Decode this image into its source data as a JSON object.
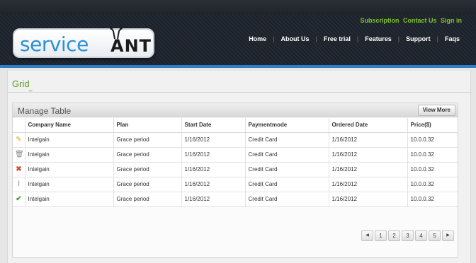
{
  "header": {
    "top_links": [
      "Subscription",
      "Contact Us",
      "Sign in"
    ],
    "logo": {
      "left": "service",
      "right": "ANT"
    },
    "nav": [
      "Home",
      "About Us",
      "Free trial",
      "Features",
      "Support",
      "Faqs"
    ]
  },
  "page": {
    "title": "Grid"
  },
  "panel": {
    "title": "Manage Table",
    "view_more": "View More",
    "columns": [
      "Company Name",
      "Plan",
      "Start Date",
      "Paymentmode",
      "Ordered Date",
      "Price($)"
    ],
    "rows": [
      {
        "icon": "edit-icon",
        "glyph": "✎",
        "cells": [
          "Intelgain",
          "Grace period",
          "1/16/2012",
          "Credit Card",
          "1/16/2012",
          "10.0.0.32"
        ]
      },
      {
        "icon": "trash-icon",
        "glyph": "🗑",
        "cells": [
          "Intelgain",
          "Grace period",
          "1/16/2012",
          "Credit Card",
          "1/16/2012",
          "10.0.0.32"
        ]
      },
      {
        "icon": "delete-x-icon",
        "glyph": "✖",
        "cells": [
          "Intelgain",
          "Grace period",
          "1/16/2012",
          "Credit Card",
          "1/16/2012",
          "10.0.0.32"
        ]
      },
      {
        "icon": "paperclip-icon",
        "glyph": "⌇",
        "cells": [
          "Intelgain",
          "Grace period",
          "1/16/2012",
          "Credit Card",
          "1/16/2012",
          "10.0.0.32"
        ]
      },
      {
        "icon": "checkmark-icon",
        "glyph": "✔",
        "cells": [
          "Intelgain",
          "Grace period",
          "1/16/2012",
          "Credit Card",
          "1/16/2012",
          "10.0.0.32"
        ]
      }
    ]
  },
  "pager": {
    "prev": "◀",
    "pages": [
      "1",
      "2",
      "3",
      "4",
      "5"
    ],
    "next": "▶"
  },
  "colors": {
    "accent_blue": "#2e7fc4",
    "accent_green": "#5a9a1a",
    "link_green": "#7cc22a"
  }
}
